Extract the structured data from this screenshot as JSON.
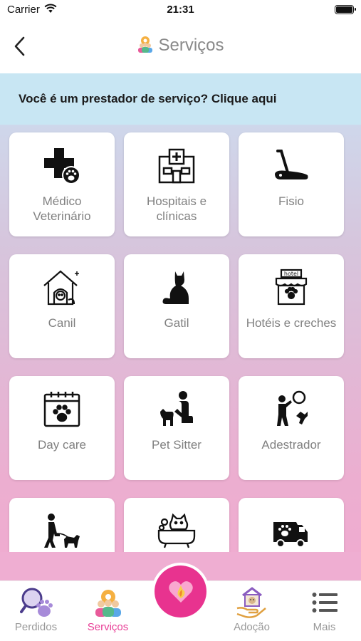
{
  "status_bar": {
    "carrier": "Carrier",
    "time": "21:31"
  },
  "navbar": {
    "title": "Serviços",
    "back_icon": "chevron-left-icon"
  },
  "banner": {
    "text": "Você é um prestador de serviço? Clique aqui"
  },
  "services": [
    {
      "label": "Médico Veterinário",
      "icon": "vet-cross-paw-icon"
    },
    {
      "label": "Hospitais e clínicas",
      "icon": "hospital-icon"
    },
    {
      "label": "Fisio",
      "icon": "treadmill-icon"
    },
    {
      "label": "Canil",
      "icon": "dog-house-icon"
    },
    {
      "label": "Gatil",
      "icon": "cat-icon"
    },
    {
      "label": "Hotéis e creches",
      "icon": "pet-hotel-icon"
    },
    {
      "label": "Day care",
      "icon": "calendar-paw-icon"
    },
    {
      "label": "Pet Sitter",
      "icon": "pet-sitter-icon"
    },
    {
      "label": "Adestrador",
      "icon": "dog-trainer-icon"
    },
    {
      "label": "",
      "icon": "dog-walker-icon"
    },
    {
      "label": "",
      "icon": "bath-cat-icon"
    },
    {
      "label": "",
      "icon": "pet-van-icon"
    }
  ],
  "tabs": [
    {
      "label": "Perdidos",
      "icon": "magnifier-paw-icon"
    },
    {
      "label": "Serviços",
      "icon": "service-people-icon",
      "active": true
    },
    {
      "label": "",
      "icon": "heart-fab-icon"
    },
    {
      "label": "Adoção",
      "icon": "adoption-hand-icon"
    },
    {
      "label": "Mais",
      "icon": "list-icon"
    }
  ],
  "colors": {
    "accent": "#e8338f",
    "banner": "#c8e6f3",
    "tab_inactive": "#999999"
  }
}
